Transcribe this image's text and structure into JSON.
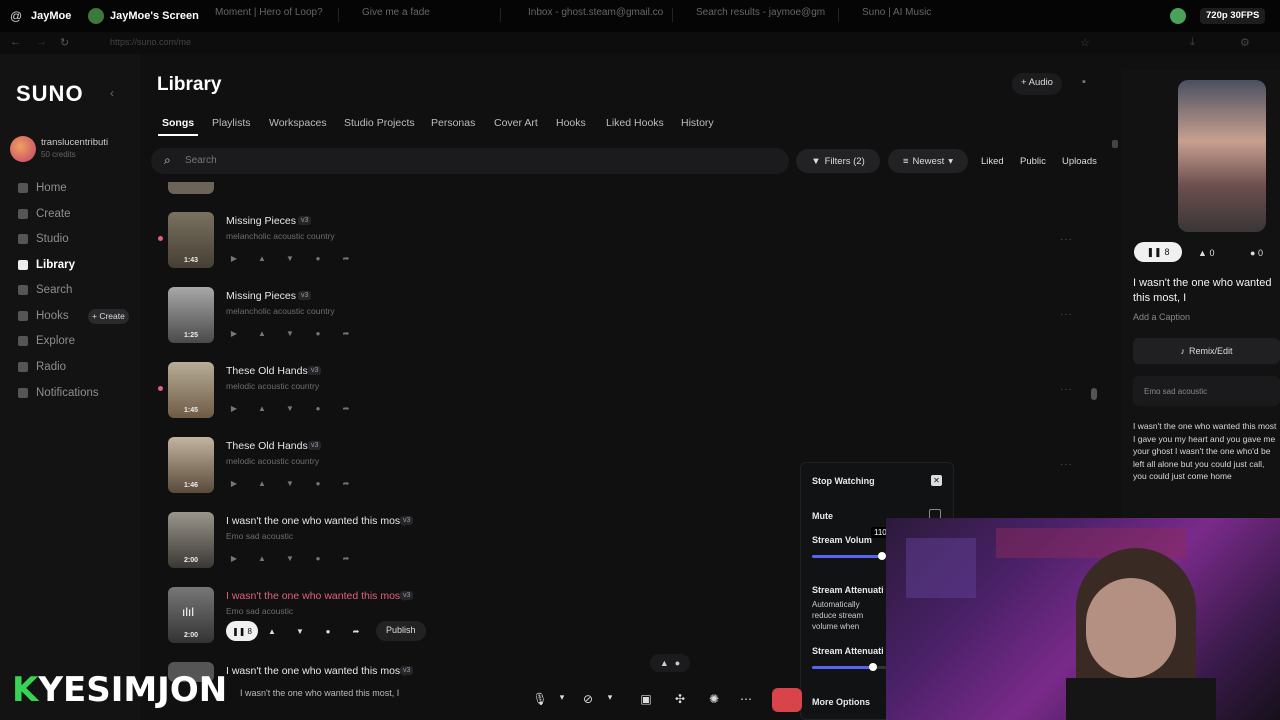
{
  "discord": {
    "user": "JayMoe",
    "screen_title": "JayMoe's Screen",
    "stream_quality": "720p 30FPS",
    "browser_tabs": [
      "Moment | Hero of Loop?",
      "Give me a fade",
      "Inbox - ghost.steam@gmail.co",
      "Search results - jaymoe@gm",
      "Suno | AI Music"
    ],
    "url": "https://suno.com/me"
  },
  "suno": {
    "logo": "SUNO",
    "user": {
      "name": "translucentributi",
      "credits": "50 credits"
    },
    "nav": [
      {
        "label": "Home",
        "icon": "home-icon"
      },
      {
        "label": "Create",
        "icon": "music-note-icon"
      },
      {
        "label": "Studio",
        "icon": "studio-icon"
      },
      {
        "label": "Library",
        "icon": "library-icon",
        "active": true
      },
      {
        "label": "Search",
        "icon": "search-icon"
      },
      {
        "label": "Hooks",
        "icon": "hooks-icon"
      },
      {
        "label": "Explore",
        "icon": "explore-icon"
      },
      {
        "label": "Radio",
        "icon": "radio-icon"
      },
      {
        "label": "Notifications",
        "icon": "bell-icon"
      }
    ],
    "hooks_create_label": "+ Create",
    "page_title": "Library",
    "audio_button": "+ Audio",
    "subtabs": [
      "Songs",
      "Playlists",
      "Workspaces",
      "Studio Projects",
      "Personas",
      "Cover Art",
      "Hooks",
      "Liked Hooks",
      "History"
    ],
    "search_placeholder": "Search",
    "filters": {
      "filters": "Filters (2)",
      "sort": "Newest",
      "liked": "Liked",
      "public": "Public",
      "uploads": "Uploads"
    },
    "songs": [
      {
        "title": "Missing Pieces",
        "version": "v3",
        "style": "melancholic acoustic country",
        "duration": "1:43"
      },
      {
        "title": "Missing Pieces",
        "version": "v3",
        "style": "melancholic acoustic country",
        "duration": "1:25"
      },
      {
        "title": "These Old Hands",
        "version": "v3",
        "style": "melodic acoustic country",
        "duration": "1:45"
      },
      {
        "title": "These Old Hands",
        "version": "v3",
        "style": "melodic acoustic country",
        "duration": "1:46"
      },
      {
        "title": "I wasn't the one who wanted this most, I",
        "version": "v3",
        "style": "Emo sad acoustic",
        "duration": "2:00"
      },
      {
        "title": "I wasn't the one who wanted this most, I",
        "version": "v3",
        "style": "Emo sad acoustic",
        "duration": "2:00",
        "playing": true,
        "play_count": "8",
        "publish": "Publish"
      },
      {
        "title": "I wasn't the one who wanted this most, I",
        "version": "v3",
        "style": "",
        "duration": ""
      }
    ],
    "player_bar_title": "I wasn't the one who wanted this most, I",
    "right_panel": {
      "play_count": "8",
      "likes": "0",
      "comments": "0",
      "title": "I wasn't the one who wanted this most, I",
      "caption": "Add a Caption",
      "remix": "Remix/Edit",
      "style": "Emo sad acoustic",
      "lyrics": "I wasn't the one who wanted this most I gave you my heart and you gave me your ghost I wasn't the one who'd be left all alone but you could just call, you could just come home"
    }
  },
  "popup": {
    "stop": "Stop Watching",
    "mute": "Mute",
    "volume_label": "Stream Volume",
    "volume_value": "110",
    "atten_label": "Stream Attenuation",
    "atten_desc": "Automatically reduce stream volume when people are talking",
    "atten2_label": "Stream Attenuation",
    "more": "More Options",
    "volume_level": 0.55,
    "atten_level": 0.48
  },
  "overlay": {
    "name": "YESIMJON",
    "letter": "K"
  }
}
